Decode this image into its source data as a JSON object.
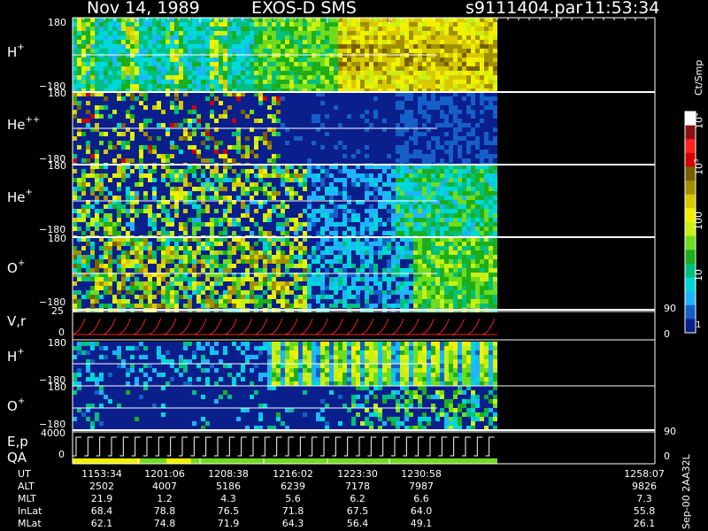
{
  "header": {
    "date": "Nov 14, 1989",
    "instrument": "EXOS-D SMS",
    "file": "s9111404.par",
    "time": "11:53:34"
  },
  "colorbar": {
    "unit_label": "Ct/Smp",
    "tick_labels": [
      "1",
      "10",
      "100",
      "10",
      "10",
      "10"
    ],
    "exponents": [
      "",
      "",
      "",
      "3",
      "4"
    ],
    "colors": [
      "#0a1f8c",
      "#1460c8",
      "#1fb4ff",
      "#00d8d8",
      "#00c080",
      "#1cae1c",
      "#6fdc1e",
      "#c8f014",
      "#f0f000",
      "#d8c800",
      "#a09000",
      "#786000",
      "#d00000",
      "#ff2020",
      "#8c1010",
      "#ffffff"
    ]
  },
  "panels": [
    {
      "id": "hplus1",
      "label": "H",
      "sup": "+",
      "ytop": "180",
      "ybot": "−180"
    },
    {
      "id": "hepp",
      "label": "He",
      "sup": "++",
      "ytop": "180",
      "ybot": "−180"
    },
    {
      "id": "heplus",
      "label": "He",
      "sup": "+",
      "ytop": "180",
      "ybot": "−180"
    },
    {
      "id": "oplus1",
      "label": "O",
      "sup": "+",
      "ytop": "180",
      "ybot": "−180"
    },
    {
      "id": "vr",
      "label": "V,r",
      "sup": "",
      "ytop": "25",
      "ybot": "0",
      "right_top": "90",
      "right_bot": "0"
    },
    {
      "id": "hplus2",
      "label": "H",
      "sup": "+",
      "ytop": "180",
      "ybot": "−180"
    },
    {
      "id": "oplus2",
      "label": "O",
      "sup": "+",
      "ytop": "180",
      "ybot": "−180",
      "right_bot": "90"
    },
    {
      "id": "ep",
      "label": "E,p",
      "label2": "QA",
      "sup": "",
      "ytop": "4000",
      "ybot": "0",
      "right_bot": "0"
    }
  ],
  "footer": {
    "rows": [
      {
        "name": "UT",
        "values": [
          "1153:34",
          "1201:06",
          "1208:38",
          "1216:02",
          "1223:30",
          "1230:58",
          "1258:07"
        ]
      },
      {
        "name": "ALT",
        "values": [
          "2502",
          "4007",
          "5186",
          "6239",
          "7178",
          "7987",
          "9826"
        ]
      },
      {
        "name": "MLT",
        "values": [
          "21.9",
          "1.2",
          "4.3",
          "5.6",
          "6.2",
          "6.6",
          "7.3"
        ]
      },
      {
        "name": "InLat",
        "values": [
          "68.4",
          "78.8",
          "76.5",
          "71.8",
          "67.5",
          "64.0",
          "55.8"
        ]
      },
      {
        "name": "MLat",
        "values": [
          "62.1",
          "74.8",
          "71.9",
          "64.3",
          "56.4",
          "49.1",
          "26.1"
        ]
      }
    ],
    "version": "Sep-00  2AA32L"
  },
  "chart_data": {
    "type": "heatmap",
    "title": "Nov 14, 1989   EXOS-D SMS",
    "time_ticks": [
      "1153:34",
      "1201:06",
      "1208:38",
      "1216:02",
      "1223:30",
      "1230:58",
      "1258:07"
    ],
    "ion_panels": [
      "H+",
      "He++",
      "He+",
      "O+",
      "H+",
      "O+"
    ],
    "pitch_angle_range": [
      -180,
      180
    ],
    "vr_range": [
      0,
      25
    ],
    "ep_range": [
      0,
      4000
    ],
    "color_scale": "log",
    "color_range": [
      1,
      10000
    ],
    "data_fraction_of_axis": 0.73
  }
}
